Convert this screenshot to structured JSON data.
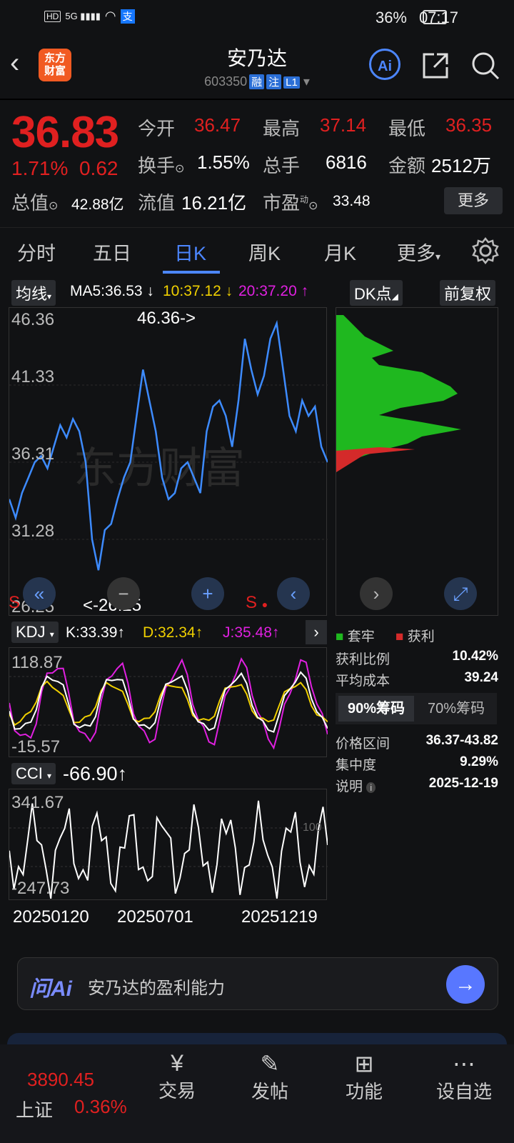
{
  "status": {
    "net": "HD",
    "sig": "5G",
    "pay": "支",
    "battery": "36%",
    "time": "07:17"
  },
  "header": {
    "logo_line1": "东方",
    "logo_line2": "财富",
    "title": "安乃达",
    "code": "603350",
    "tags": [
      "融",
      "注",
      "L1"
    ],
    "ai": "Ai"
  },
  "quote": {
    "price": "36.83",
    "pct": "1.71%",
    "chg": "0.62",
    "open_l": "今开",
    "open": "36.47",
    "high_l": "最高",
    "high": "37.14",
    "low_l": "最低",
    "low": "36.35",
    "turn_l": "换手",
    "turn": "1.55%",
    "vol_l": "总手",
    "vol": "6816",
    "amt_l": "金额",
    "amt": "2512万",
    "mcap_l": "总值",
    "mcap": "42.88亿",
    "float_l": "流值",
    "float": "16.21亿",
    "pe_l": "市盈",
    "pe_sup": "动",
    "pe": "33.48",
    "more": "更多"
  },
  "tabs": [
    "分时",
    "五日",
    "日K",
    "周K",
    "月K",
    "更多"
  ],
  "chart": {
    "ma_chip": "均线",
    "ma5": "MA5:36.53",
    "ma10": "10:37.12",
    "ma20": "20:37.20",
    "dk": "DK点",
    "fq": "前复权",
    "y": [
      "46.36",
      "41.33",
      "36.31",
      "31.28",
      "26.25"
    ],
    "max_label": "46.36->",
    "min_label": "<-26.25",
    "sell": "S",
    "watermark": "东方财富",
    "kdj_chip": "KDJ",
    "k": "K:33.39",
    "d": "D:32.34",
    "j": "J:35.48",
    "kdj_top": "118.87",
    "kdj_bot": "-15.57",
    "cci_chip": "CCI",
    "cci": "-66.90",
    "cci_top": "341.67",
    "cci_bot": "-247.73",
    "cci_100": "100",
    "dates": [
      "20250120",
      "20250701",
      "20251219"
    ]
  },
  "chips": {
    "trapped": "套牢",
    "profit": "获利",
    "rows": [
      {
        "l": "获利比例",
        "v": "10.42%"
      },
      {
        "l": "平均成本",
        "v": "39.24"
      }
    ],
    "tab90": "90%筹码",
    "tab70": "70%筹码",
    "rows2": [
      {
        "l": "价格区间",
        "v": "36.37-43.82"
      },
      {
        "l": "集中度",
        "v": "9.29%"
      },
      {
        "l": "说明",
        "v": "2025-12-19"
      }
    ]
  },
  "ai_bar": {
    "brand": "问Ai",
    "prompt": "安乃达的盈利能力"
  },
  "bottom": {
    "index": "3890.45",
    "index_name": "上证",
    "index_pct": "0.36%",
    "items": [
      "交易",
      "发帖",
      "功能",
      "设自选"
    ]
  },
  "colors": {
    "up": "#e02020",
    "accent": "#4c86ff",
    "green": "#22b322"
  }
}
